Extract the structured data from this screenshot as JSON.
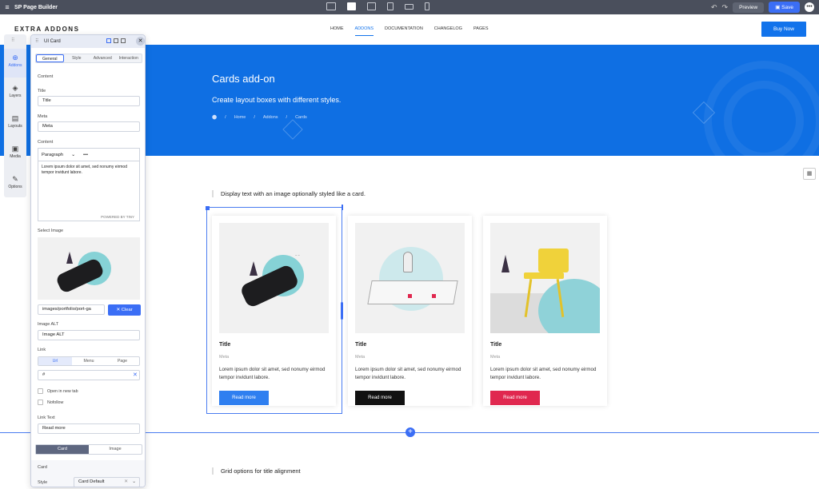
{
  "app": {
    "title": "SP Page Builder",
    "preview_label": "Preview",
    "save_label": "Save"
  },
  "site": {
    "logo": "EXTRA ADDONS",
    "nav": [
      "HOME",
      "ADDONS",
      "DOCUMENTATION",
      "CHANGELOG",
      "PAGES"
    ],
    "nav_active": "ADDONS",
    "buy_label": "Buy Now",
    "hero_title": "Cards add-on",
    "hero_sub": "Create layout boxes with different styles.",
    "breadcrumb": [
      "Home",
      "Addons",
      "Cards"
    ],
    "section1": "Display text with an image optionally styled like a card.",
    "section2": "Grid options for title alignment",
    "cards": [
      {
        "title": "Title",
        "meta": "Meta",
        "text": "Lorem ipsum dolor sit amet, sed nonumy eirmod tempor invidunt labore.",
        "button": "Read more",
        "button_color": "#2f7ff0"
      },
      {
        "title": "Title",
        "meta": "Meta",
        "text": "Lorem ipsum dolor sit amet, sed nonumy eirmod tempor invidunt labore.",
        "button": "Read more",
        "button_color": "#111111"
      },
      {
        "title": "Title",
        "meta": "Meta",
        "text": "Lorem ipsum dolor sit amet, sed nonumy eirmod tempor invidunt labore.",
        "button": "Read more",
        "button_color": "#e0284f"
      }
    ]
  },
  "sidebar": [
    {
      "label": "Addons",
      "icon": "plus-circle-icon",
      "glyph": "⊕"
    },
    {
      "label": "Layers",
      "icon": "layers-icon",
      "glyph": "◈"
    },
    {
      "label": "Layouts",
      "icon": "layout-icon",
      "glyph": "▤"
    },
    {
      "label": "Media",
      "icon": "media-icon",
      "glyph": "▣"
    },
    {
      "label": "Options",
      "icon": "options-icon",
      "glyph": "✎"
    }
  ],
  "panel": {
    "title": "UI Card",
    "tabs": [
      "General",
      "Style",
      "Advanced",
      "Interaction"
    ],
    "content_label": "Content",
    "title_label": "Title",
    "title_value": "Title",
    "meta_label": "Meta",
    "meta_value": "Meta",
    "content_field_label": "Content",
    "paragraph": "Paragraph",
    "more": "•••",
    "editor_text": "Lorem ipsum dolor sit amet, sed nonumy eirmod tempor invidunt labore.",
    "powered": "POWERED BY TINY",
    "select_image_label": "Select Image",
    "image_path": "images/portfolio/port-ga",
    "clear_label": "Clear",
    "image_alt_label": "Image ALT",
    "image_alt_value": "Image ALT",
    "link_label": "Link",
    "link_types": [
      "Url",
      "Menu",
      "Page"
    ],
    "url_value": "#",
    "open_new_tab": "Open in new tab",
    "nofollow": "Nofollow",
    "link_text_label": "Link Text",
    "link_text_value": "Read more",
    "mode_tabs": [
      "Card",
      "Image"
    ],
    "card_section": "Card",
    "style_label": "Style",
    "style_value": "Card Default"
  }
}
